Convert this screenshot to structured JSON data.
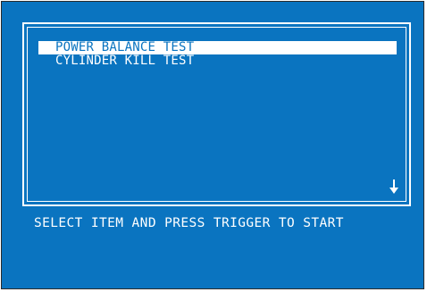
{
  "menu": {
    "items": [
      {
        "label": "POWER BALANCE TEST",
        "selected": true
      },
      {
        "label": "CYLINDER KILL TEST",
        "selected": false
      }
    ],
    "scroll_icon": "arrow-down-icon"
  },
  "prompt_text": "SELECT ITEM AND PRESS TRIGGER TO START",
  "colors": {
    "background": "#0a74c0",
    "foreground": "#ffffff"
  }
}
